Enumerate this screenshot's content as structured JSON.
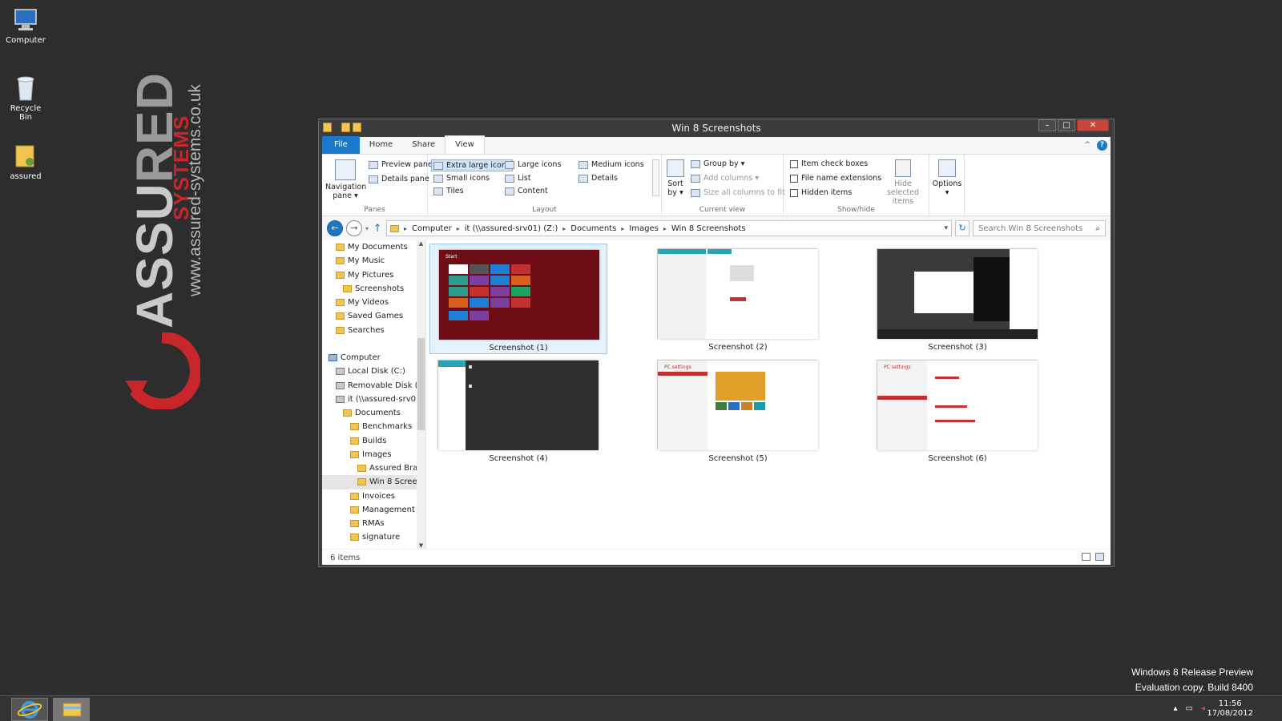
{
  "desktop": {
    "icons": [
      {
        "label": "Computer",
        "icon": "computer-icon"
      },
      {
        "label": "Recycle Bin",
        "icon": "recycle-bin-icon"
      },
      {
        "label": "assured",
        "icon": "user-folder-icon"
      }
    ],
    "branding": {
      "word_light": "ASSU",
      "word_dark": "RED",
      "sub": "SYSTEMS",
      "url": "www.assured-systems.co.uk"
    },
    "watermark": {
      "line1": "Windows 8 Release Preview",
      "line2": "Evaluation copy. Build 8400"
    }
  },
  "window": {
    "title": "Win 8 Screenshots",
    "controls": {
      "minimize": "–",
      "maximize": "□",
      "close": "✕"
    }
  },
  "ribbon": {
    "tabs": [
      {
        "label": "File",
        "state": "file"
      },
      {
        "label": "Home",
        "state": ""
      },
      {
        "label": "Share",
        "state": ""
      },
      {
        "label": "View",
        "state": "active"
      }
    ],
    "help": "?",
    "collapse": "^",
    "panes": {
      "nav_pane": "Navigation",
      "nav_pane2": "pane ▾",
      "preview": "Preview pane",
      "details": "Details pane",
      "label": "Panes"
    },
    "layout": {
      "items": [
        "Extra large icons",
        "Large icons",
        "Medium icons",
        "Small icons",
        "List",
        "Details",
        "Tiles",
        "Content"
      ],
      "label": "Layout"
    },
    "current_view": {
      "sort1": "Sort",
      "sort2": "by ▾",
      "group": "Group by ▾",
      "add_cols": "Add columns ▾",
      "size_cols": "Size all columns to fit",
      "label": "Current view"
    },
    "show_hide": {
      "item_check": "Item check boxes",
      "file_ext": "File name extensions",
      "hidden": "Hidden items",
      "hide_sel1": "Hide selected",
      "hide_sel2": "items",
      "label": "Show/hide"
    },
    "options": {
      "label": "Options",
      "arrow": "▾"
    }
  },
  "address": {
    "back": "←",
    "forward": "→",
    "recent": "▾",
    "up": "↑",
    "path": [
      "Computer",
      "it (\\\\assured-srv01) (Z:)",
      "Documents",
      "Images",
      "Win 8 Screenshots"
    ],
    "sep": "▸",
    "dropdown": "▾",
    "refresh": "↻",
    "search_placeholder": "Search Win 8 Screenshots",
    "search_icon": "⌕"
  },
  "tree": {
    "items": [
      {
        "label": "My Documents",
        "indent": 1,
        "icon": "folder"
      },
      {
        "label": "My Music",
        "indent": 1,
        "icon": "folder"
      },
      {
        "label": "My Pictures",
        "indent": 1,
        "icon": "folder"
      },
      {
        "label": "Screenshots",
        "indent": 2,
        "icon": "folder"
      },
      {
        "label": "My Videos",
        "indent": 1,
        "icon": "folder"
      },
      {
        "label": "Saved Games",
        "indent": 1,
        "icon": "folder"
      },
      {
        "label": "Searches",
        "indent": 1,
        "icon": "folder"
      },
      {
        "label": "",
        "indent": 0,
        "icon": "none"
      },
      {
        "label": "Computer",
        "indent": 0,
        "icon": "pc"
      },
      {
        "label": "Local Disk (C:)",
        "indent": 1,
        "icon": "disk"
      },
      {
        "label": "Removable Disk (",
        "indent": 1,
        "icon": "disk"
      },
      {
        "label": "it (\\\\assured-srv0",
        "indent": 1,
        "icon": "disk"
      },
      {
        "label": "Documents",
        "indent": 2,
        "icon": "folder"
      },
      {
        "label": "Benchmarks",
        "indent": 3,
        "icon": "folder"
      },
      {
        "label": "Builds",
        "indent": 3,
        "icon": "folder"
      },
      {
        "label": "Images",
        "indent": 3,
        "icon": "folder"
      },
      {
        "label": "Assured Bra",
        "indent": 4,
        "icon": "folder"
      },
      {
        "label": "Win 8 Scree",
        "indent": 4,
        "icon": "folder",
        "selected": true
      },
      {
        "label": "Invoices",
        "indent": 3,
        "icon": "folder"
      },
      {
        "label": "Management",
        "indent": 3,
        "icon": "folder"
      },
      {
        "label": "RMAs",
        "indent": 3,
        "icon": "folder"
      },
      {
        "label": "signature",
        "indent": 3,
        "icon": "folder"
      }
    ],
    "scroll_up": "▲",
    "scroll_down": "▼"
  },
  "files": [
    {
      "name": "Screenshot (1)",
      "style": "start",
      "selected": true
    },
    {
      "name": "Screenshot (2)",
      "style": "white"
    },
    {
      "name": "Screenshot (3)",
      "style": "dark"
    },
    {
      "name": "Screenshot (4)",
      "style": "darkside"
    },
    {
      "name": "Screenshot (5)",
      "style": "pcsettings-photo"
    },
    {
      "name": "Screenshot (6)",
      "style": "pcsettings"
    }
  ],
  "status": {
    "count": "6 items"
  },
  "taskbar": {
    "time": "11:56",
    "date": "17/08/2012",
    "apps": [
      {
        "name": "ie-icon"
      },
      {
        "name": "explorer-icon"
      }
    ],
    "tray": {
      "show_hidden": "▴",
      "network": "▭",
      "volume": "◂"
    }
  },
  "colors": {
    "accent": "#1979ca",
    "close": "#c7463c",
    "brand_red": "#c8262b"
  }
}
